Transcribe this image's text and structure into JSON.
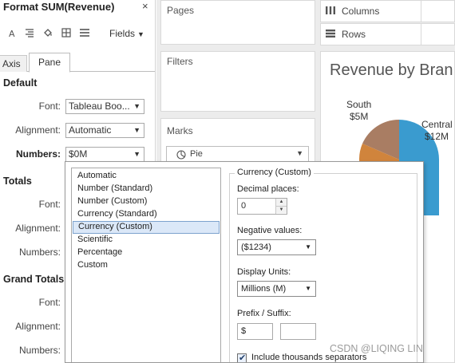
{
  "format_pane": {
    "title": "Format SUM(Revenue)",
    "close_glyph": "×",
    "fields_label": "Fields",
    "toolbar_icons": [
      "font-icon",
      "alignment-icon",
      "shading-icon",
      "borders-icon",
      "lines-icon"
    ],
    "tabs": {
      "axis": "Axis",
      "pane": "Pane"
    },
    "default": {
      "heading": "Default",
      "font_label": "Font:",
      "font_value": "Tableau Boo...",
      "alignment_label": "Alignment:",
      "alignment_value": "Automatic",
      "numbers_label": "Numbers:",
      "numbers_value": "$0M"
    },
    "totals": {
      "heading": "Totals",
      "font_label": "Font:",
      "alignment_label": "Alignment:",
      "numbers_label": "Numbers:"
    },
    "grand_totals": {
      "heading": "Grand Totals",
      "font_label": "Font:",
      "alignment_label": "Alignment:",
      "numbers_label": "Numbers:"
    }
  },
  "shelves": {
    "pages": "Pages",
    "filters": "Filters",
    "marks": "Marks",
    "mark_type": "Pie",
    "columns": "Columns",
    "rows": "Rows"
  },
  "viz": {
    "title": "Revenue by Bran",
    "pie_labels": [
      {
        "region": "South",
        "value": "$5M"
      },
      {
        "region": "Central",
        "value": "$12M"
      }
    ],
    "colors": {
      "central": "#3a9bcf",
      "south": "#a97d63",
      "other": "#d0843c"
    }
  },
  "number_format": {
    "list_items": [
      "Automatic",
      "Number (Standard)",
      "Number (Custom)",
      "Currency (Standard)",
      "Currency (Custom)",
      "Scientific",
      "Percentage",
      "Custom"
    ],
    "selected_item": "Currency (Custom)",
    "group_title": "Currency (Custom)",
    "decimal_places_label": "Decimal places:",
    "decimal_places_value": "0",
    "negative_values_label": "Negative values:",
    "negative_values_value": "($1234)",
    "display_units_label": "Display Units:",
    "display_units_value": "Millions (M)",
    "prefix_suffix_label": "Prefix / Suffix:",
    "prefix_value": "$",
    "suffix_value": "",
    "thousands_separator_label": "Include thousands separators",
    "thousands_separator_checked": true
  },
  "watermark": "CSDN @LIQING LIN"
}
